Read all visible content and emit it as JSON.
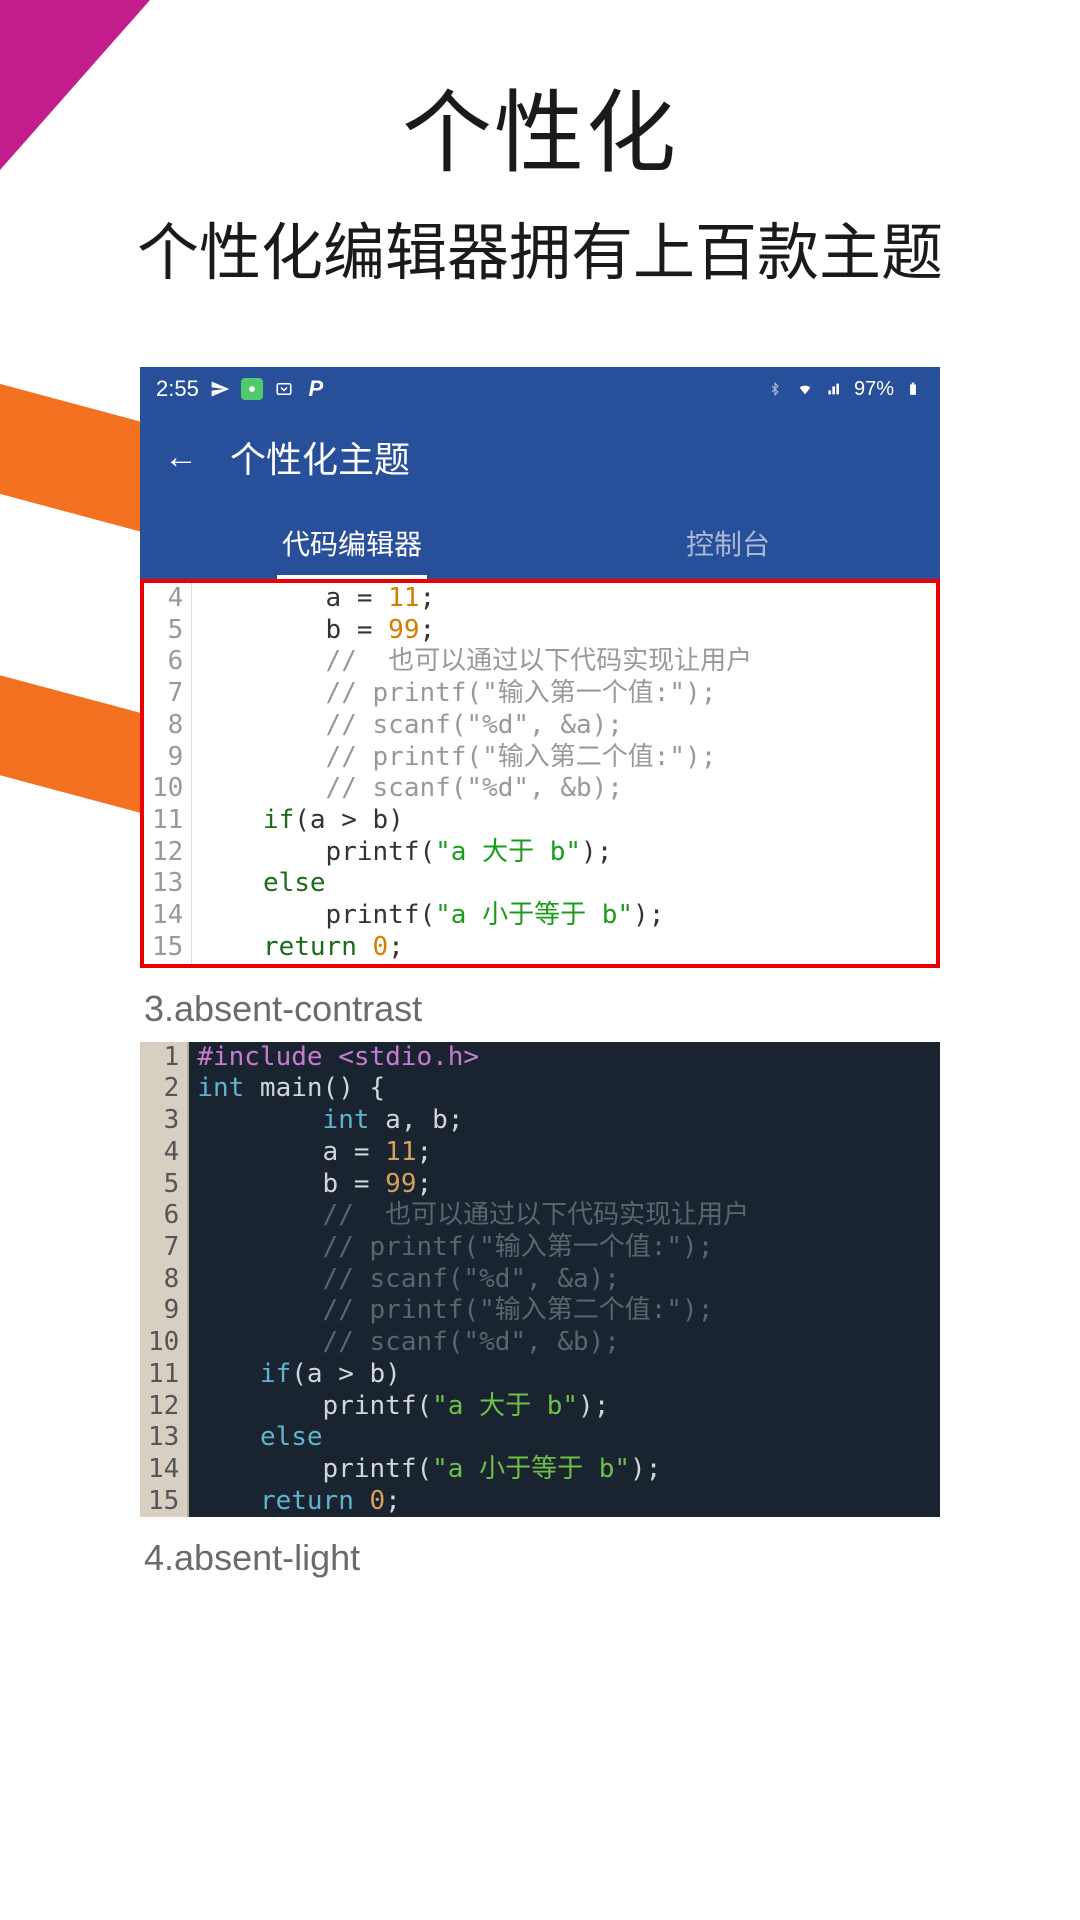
{
  "hero": {
    "title": "个性化",
    "subtitle": "个性化编辑器拥有上百款主题"
  },
  "status_bar": {
    "time": "2:55",
    "battery_text": "97%"
  },
  "app_bar": {
    "title": "个性化主题"
  },
  "tabs": {
    "tab1": "代码编辑器",
    "tab2": "控制台"
  },
  "code_light": {
    "gutter": "4\n5\n6\n7\n8\n9\n10\n11\n12\n13\n14\n15",
    "lines": [
      {
        "indent": "        ",
        "tokens": [
          {
            "t": "plain",
            "v": "a = "
          },
          {
            "t": "num",
            "v": "11"
          },
          {
            "t": "plain",
            "v": ";"
          }
        ],
        "partial": true
      },
      {
        "indent": "        ",
        "tokens": [
          {
            "t": "plain",
            "v": "b = "
          },
          {
            "t": "num",
            "v": "99"
          },
          {
            "t": "plain",
            "v": ";"
          }
        ]
      },
      {
        "indent": "        ",
        "tokens": [
          {
            "t": "com",
            "v": "//  也可以通过以下代码实现让用户"
          }
        ]
      },
      {
        "indent": "        ",
        "tokens": [
          {
            "t": "com",
            "v": "// printf(\"输入第一个值:\");"
          }
        ]
      },
      {
        "indent": "        ",
        "tokens": [
          {
            "t": "com",
            "v": "// scanf(\"%d\", &a);"
          }
        ]
      },
      {
        "indent": "        ",
        "tokens": [
          {
            "t": "com",
            "v": "// printf(\"输入第二个值:\");"
          }
        ]
      },
      {
        "indent": "        ",
        "tokens": [
          {
            "t": "com",
            "v": "// scanf(\"%d\", &b);"
          }
        ]
      },
      {
        "indent": "    ",
        "tokens": [
          {
            "t": "kw",
            "v": "if"
          },
          {
            "t": "plain",
            "v": "(a > b)"
          }
        ]
      },
      {
        "indent": "        ",
        "tokens": [
          {
            "t": "fn",
            "v": "printf"
          },
          {
            "t": "plain",
            "v": "("
          },
          {
            "t": "str",
            "v": "\"a 大于 b\""
          },
          {
            "t": "plain",
            "v": ");"
          }
        ]
      },
      {
        "indent": "    ",
        "tokens": [
          {
            "t": "kw",
            "v": "else"
          }
        ]
      },
      {
        "indent": "        ",
        "tokens": [
          {
            "t": "fn",
            "v": "printf"
          },
          {
            "t": "plain",
            "v": "("
          },
          {
            "t": "str",
            "v": "\"a 小于等于 b\""
          },
          {
            "t": "plain",
            "v": ");"
          }
        ]
      },
      {
        "indent": "    ",
        "tokens": [
          {
            "t": "kw",
            "v": "return"
          },
          {
            "t": "plain",
            "v": " "
          },
          {
            "t": "num",
            "v": "0"
          },
          {
            "t": "plain",
            "v": ";"
          }
        ]
      }
    ]
  },
  "theme_labels": {
    "label3": "3.absent-contrast",
    "label4": "4.absent-light"
  },
  "code_dark": {
    "gutter": "1\n2\n3\n4\n5\n6\n7\n8\n9\n10\n11\n12\n13\n14\n15",
    "lines": [
      {
        "indent": "",
        "tokens": [
          {
            "t": "inc",
            "v": "#include <stdio.h>"
          }
        ]
      },
      {
        "indent": "",
        "tokens": [
          {
            "t": "kw",
            "v": "int"
          },
          {
            "t": "plain",
            "v": " main() {"
          }
        ]
      },
      {
        "indent": "        ",
        "tokens": [
          {
            "t": "kw",
            "v": "int"
          },
          {
            "t": "plain",
            "v": " a, b;"
          }
        ]
      },
      {
        "indent": "        ",
        "tokens": [
          {
            "t": "plain",
            "v": "a = "
          },
          {
            "t": "num",
            "v": "11"
          },
          {
            "t": "plain",
            "v": ";"
          }
        ]
      },
      {
        "indent": "        ",
        "tokens": [
          {
            "t": "plain",
            "v": "b = "
          },
          {
            "t": "num",
            "v": "99"
          },
          {
            "t": "plain",
            "v": ";"
          }
        ]
      },
      {
        "indent": "        ",
        "tokens": [
          {
            "t": "com",
            "v": "//  也可以通过以下代码实现让用户"
          }
        ]
      },
      {
        "indent": "        ",
        "tokens": [
          {
            "t": "com",
            "v": "// printf(\"输入第一个值:\");"
          }
        ]
      },
      {
        "indent": "        ",
        "tokens": [
          {
            "t": "com",
            "v": "// scanf(\"%d\", &a);"
          }
        ]
      },
      {
        "indent": "        ",
        "tokens": [
          {
            "t": "com",
            "v": "// printf(\"输入第二个值:\");"
          }
        ]
      },
      {
        "indent": "        ",
        "tokens": [
          {
            "t": "com",
            "v": "// scanf(\"%d\", &b);"
          }
        ]
      },
      {
        "indent": "    ",
        "tokens": [
          {
            "t": "kw",
            "v": "if"
          },
          {
            "t": "plain",
            "v": "(a > b)"
          }
        ]
      },
      {
        "indent": "        ",
        "tokens": [
          {
            "t": "plain",
            "v": "printf("
          },
          {
            "t": "str",
            "v": "\"a 大于 b\""
          },
          {
            "t": "plain",
            "v": ");"
          }
        ]
      },
      {
        "indent": "    ",
        "tokens": [
          {
            "t": "kw",
            "v": "else"
          }
        ]
      },
      {
        "indent": "        ",
        "tokens": [
          {
            "t": "plain",
            "v": "printf("
          },
          {
            "t": "str",
            "v": "\"a 小于等于 b\""
          },
          {
            "t": "plain",
            "v": ");"
          }
        ]
      },
      {
        "indent": "    ",
        "tokens": [
          {
            "t": "kw",
            "v": "return"
          },
          {
            "t": "plain",
            "v": " "
          },
          {
            "t": "num",
            "v": "0"
          },
          {
            "t": "plain",
            "v": ";"
          }
        ]
      }
    ]
  }
}
